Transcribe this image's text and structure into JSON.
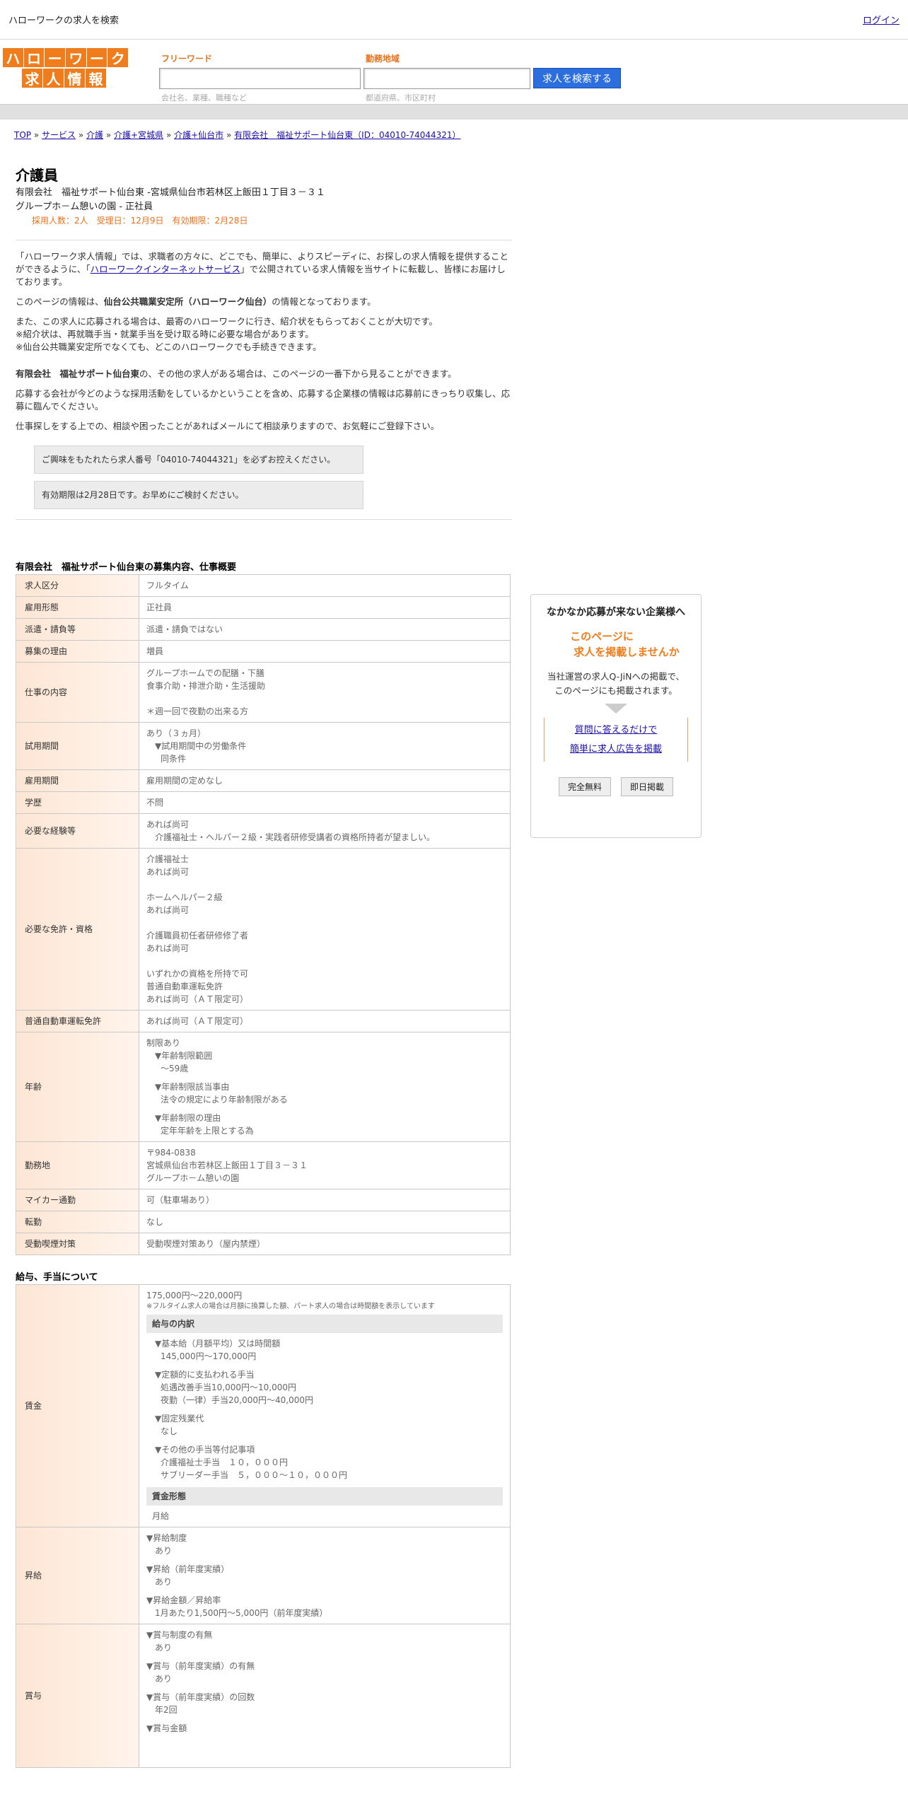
{
  "topbar": {
    "title": "ハローワークの求人を検索",
    "login": "ログイン"
  },
  "logo": {
    "row1": [
      "ハ",
      "ロ",
      "ー",
      "ワ",
      "ー",
      "ク"
    ],
    "row2": [
      "求",
      "人",
      "情",
      "報"
    ]
  },
  "search": {
    "keyword_label": "フリーワード",
    "keyword_placeholder": "会社名、業種、職種など",
    "area_label": "勤務地域",
    "area_placeholder": "都道府県、市区町村",
    "button": "求人を検索する"
  },
  "breadcrumb": [
    "TOP",
    "サービス",
    "介護",
    "介護+宮城県",
    "介護+仙台市",
    "有限会社　福祉サポート仙台東（ID：04010-74044321）"
  ],
  "job": {
    "title": "介護員",
    "line1": "有限会社　福祉サポート仙台東 -宮城県仙台市若林区上飯田１丁目３－３１",
    "line2": "グループホ－ム憩いの園 - 正社員",
    "meta": "採用人数：2人　受理日：12月9日　有効期限：2月28日"
  },
  "intro": {
    "p1a": "「ハローワーク求人情報」では、求職者の方々に、どこでも、簡単に、よりスピーディに、お探しの求人情報を提供することができるように、「",
    "p1link": "ハローワークインターネットサービス",
    "p1b": "」で公開されている求人情報を当サイトに転載し、皆様にお届けしております。",
    "p2a": "このページの情報は、",
    "p2b": "仙台公共職業安定所（ハローワーク仙台）",
    "p2c": "の情報となっております。",
    "p3": "また、この求人に応募される場合は、最寄のハローワークに行き、紹介状をもらっておくことが大切です。",
    "p3b": "※紹介状は、再就職手当・就業手当を受け取る時に必要な場合があります。",
    "p3c": "※仙台公共職業安定所でなくても、どこのハローワークでも手続きできます。",
    "p4a": "有限会社　福祉サポート仙台東",
    "p4b": "の、その他の求人がある場合は、このページの一番下から見ることができます。",
    "p5": "応募する会社が今どのような採用活動をしているかということを含め、応募する企業様の情報は応募前にきっちり収集し、応募に臨んでください。",
    "p6": "仕事探しをする上での、相談や困ったことがあればメールにて相談承りますので、お気軽にご登録下さい。"
  },
  "notices": [
    "ご興味をもたれたら求人番号「04010-74044321」を必ずお控えください。",
    "有効期限は2月28日です。お早めにご検討ください。"
  ],
  "section1_title": "有限会社　福祉サポート仙台東の募集内容、仕事概要",
  "rows": {
    "kubun": {
      "k": "求人区分",
      "v": "フルタイム"
    },
    "keitai": {
      "k": "雇用形態",
      "v": "正社員"
    },
    "haken": {
      "k": "派遣・請負等",
      "v": "派遣・請負ではない"
    },
    "riyu": {
      "k": "募集の理由",
      "v": "増員"
    },
    "naiyo": {
      "k": "仕事の内容",
      "v1": "グループホームでの配膳・下膳",
      "v2": "食事介助・排泄介助・生活援助",
      "v3": "＊週一回で夜勤の出来る方"
    },
    "shiyo": {
      "k": "試用期間",
      "v1": "あり（３ヵ月）",
      "v2": "▼試用期間中の労働条件",
      "v3": "同条件"
    },
    "kikan": {
      "k": "雇用期間",
      "v": "雇用期間の定めなし"
    },
    "gakureki": {
      "k": "学歴",
      "v": "不問"
    },
    "keiken": {
      "k": "必要な経験等",
      "v1": "あれば尚可",
      "v2": "介護福祉士・ヘルパー２級・実践者研修受講者の資格所持者が望ましい。"
    },
    "menkyo": {
      "k": "必要な免許・資格",
      "v1": "介護福祉士",
      "v2": "あれば尚可",
      "v3": "ホームヘルパー２級",
      "v4": "あれば尚可",
      "v5": "介護職員初任者研修修了者",
      "v6": "あれば尚可",
      "v7": "いずれかの資格を所持で可",
      "v8": "普通自動車運転免許",
      "v9": "あれば尚可（ＡＴ限定可）"
    },
    "futsu": {
      "k": "普通自動車運転免許",
      "v": "あれば尚可（ＡＴ限定可）"
    },
    "nenrei": {
      "k": "年齢",
      "v1": "制限あり",
      "v2": "▼年齢制限範囲",
      "v3": "〜59歳",
      "v4": "▼年齢制限該当事由",
      "v5": "法令の規定により年齢制限がある",
      "v6": "▼年齢制限の理由",
      "v7": "定年年齢を上限とする為"
    },
    "kinmuchi": {
      "k": "勤務地",
      "v1": "〒984-0838",
      "v2": "宮城県仙台市若林区上飯田１丁目３－３１",
      "v3": "グループホ－ム憩いの園"
    },
    "mycar": {
      "k": "マイカー通勤",
      "v": "可（駐車場あり）"
    },
    "tenkin": {
      "k": "転勤",
      "v": "なし"
    },
    "kitsuen": {
      "k": "受動喫煙対策",
      "v": "受動喫煙対策あり（屋内禁煙）"
    }
  },
  "section2_title": "給与、手当について",
  "pay": {
    "chingin": {
      "k": "賃金",
      "range": "175,000円〜220,000円",
      "note": "※フルタイム求人の場合は月額に換算した額、パート求人の場合は時間額を表示しています",
      "breakdown_hd": "給与の内訳",
      "b1": "▼基本給（月額平均）又は時間額",
      "b1v": "145,000円〜170,000円",
      "b2": "▼定額的に支払われる手当",
      "b2v1": "処遇改善手当10,000円〜10,000円",
      "b2v2": "夜勤（一律）手当20,000円〜40,000円",
      "b3": "▼固定残業代",
      "b3v": "なし",
      "b4": "▼その他の手当等付記事項",
      "b4v1": "介護福祉士手当　１０，０００円",
      "b4v2": "サブリーダー手当　５，０００～１０，０００円",
      "form_hd": "賃金形態",
      "form": "月給"
    },
    "shokyu": {
      "k": "昇給",
      "a": "▼昇給制度",
      "av": "あり",
      "b": "▼昇給（前年度実績）",
      "bv": "あり",
      "c": "▼昇給金額／昇給率",
      "cv": "1月あたり1,500円〜5,000円（前年度実績）"
    },
    "shoyo": {
      "k": "賞与",
      "a": "▼賞与制度の有無",
      "av": "あり",
      "b": "▼賞与（前年度実績）の有無",
      "bv": "あり",
      "c": "▼賞与（前年度実績）の回数",
      "cv": "年2回",
      "d": "▼賞与金額"
    }
  },
  "side": {
    "title": "なかなか応募が来ない企業様へ",
    "offer1": "このページに",
    "offer2": "求人を掲載しませんか",
    "desc1": "当社運営の求人Q-JiNへの掲載で、",
    "desc2": "このページにも掲載されます。",
    "link1": "質問に答えるだけで",
    "link2": "簡単に求人広告を掲載",
    "btn1": "完全無料",
    "btn2": "即日掲載"
  }
}
